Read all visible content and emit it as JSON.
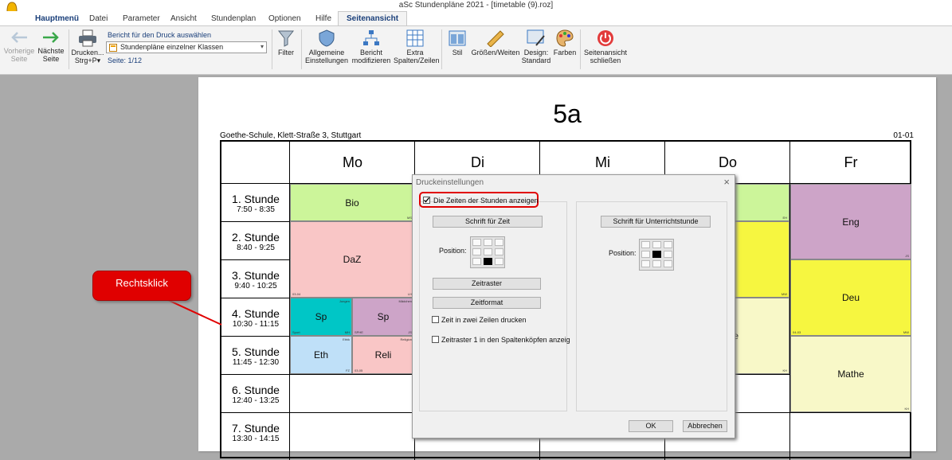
{
  "window": {
    "title": "aSc Stundenpläne 2021 - [timetable (9).roz]"
  },
  "menu_tabs": [
    {
      "label": "Hauptmenü"
    },
    {
      "label": "Datei"
    },
    {
      "label": "Parameter"
    },
    {
      "label": "Ansicht"
    },
    {
      "label": "Stundenplan"
    },
    {
      "label": "Optionen"
    },
    {
      "label": "Hilfe"
    },
    {
      "label": "Seitenansicht"
    }
  ],
  "ribbon": {
    "prev_page": {
      "line1": "Vorherige",
      "line2": "Seite"
    },
    "next_page": {
      "line1": "Nächste",
      "line2": "Seite"
    },
    "print": {
      "line1": "Drucken...",
      "line2": "Strg+P"
    },
    "report_label": "Bericht für den Druck auswählen",
    "report_select": "Stundenpläne einzelner Klassen",
    "page_info": "Seite: 1/12",
    "filter": "Filter",
    "general": {
      "line1": "Allgemeine",
      "line2": "Einstellungen"
    },
    "modify": {
      "line1": "Bericht",
      "line2": "modifizieren"
    },
    "extra": {
      "line1": "Extra",
      "line2": "Spalten/Zeilen"
    },
    "style": "Stil",
    "sizes": "Größen/Weiten",
    "design": {
      "line1": "Design:",
      "line2": "Standard"
    },
    "colors": "Farben",
    "close": {
      "line1": "Seitenansicht",
      "line2": "schließen"
    }
  },
  "page": {
    "class_title": "5a",
    "school": "Goethe-Schule, Klett-Straße 3, Stuttgart",
    "page_code": "01-01",
    "days": [
      "Mo",
      "Di",
      "Mi",
      "Do",
      "Fr"
    ],
    "periods": [
      {
        "name": "1. Stunde",
        "time": "7:50 - 8:35"
      },
      {
        "name": "2. Stunde",
        "time": "8:40 - 9:25"
      },
      {
        "name": "3. Stunde",
        "time": "9:40 - 10:25"
      },
      {
        "name": "4. Stunde",
        "time": "10:30 - 11:15"
      },
      {
        "name": "5. Stunde",
        "time": "11:45 - 12:30"
      },
      {
        "name": "6. Stunde",
        "time": "12:40 - 13:25"
      },
      {
        "name": "7. Stunde",
        "time": "13:30 - 14:15"
      }
    ],
    "lessons": {
      "mo_bio": {
        "subject": "Bio",
        "teacher": "MS"
      },
      "mo_daz": {
        "subject": "DaZ",
        "room": "03-04",
        "teacher": "LH"
      },
      "mo_sp1": {
        "subject": "Sp",
        "group": "Jungen",
        "room": "Sport",
        "teacher": "MH"
      },
      "mo_sp2": {
        "subject": "Sp",
        "group": "Mädchen",
        "room": "SPHE",
        "teacher": "JS"
      },
      "mo_eth": {
        "subject": "Eth",
        "group": "Ethik",
        "teacher": "FZ"
      },
      "mo_reli": {
        "subject": "Reli",
        "group": "Religion",
        "room": "03-05"
      },
      "do_1": {
        "teacher": "EH"
      },
      "do_2": {
        "teacher": "MW"
      },
      "do_4": {
        "subject_fragment": "e",
        "teacher": "KH"
      },
      "fr_eng": {
        "subject": "Eng",
        "teacher": "JS"
      },
      "fr_deu": {
        "subject": "Deu",
        "room": "04-03",
        "teacher": "MW"
      },
      "fr_mathe": {
        "subject": "Mathe",
        "teacher": "KH"
      }
    }
  },
  "callout": {
    "text": "Rechtsklick"
  },
  "dialog": {
    "title": "Druckeinstellungen",
    "show_times": {
      "label": "Die Zeiten der Stunden anzeigen",
      "checked": true
    },
    "font_time_button": "Schrift für Zeit",
    "position_label": "Position:",
    "time_grid_button": "Zeitraster",
    "time_format_button": "Zeitformat",
    "two_lines": {
      "label": "Zeit in zwei Zeilen drucken",
      "checked": false
    },
    "grid_in_headers": {
      "label": "Zeitraster 1 in den Spaltenköpfen anzeig",
      "checked": false
    },
    "font_lesson_button": "Schrift für Unterrichtstunde",
    "position_label_right": "Position:",
    "ok": "OK",
    "cancel": "Abbrechen"
  },
  "colors": {
    "bio": "#ccf59a",
    "daz": "#f9c6c6",
    "sport": "#00c6c6",
    "sport_girls": "#cda4c8",
    "ethik": "#bfe0f8",
    "religion": "#f9c6c6",
    "eng": "#cda4c8",
    "deu": "#f6f640",
    "mathe": "#f8f8c8",
    "callout": "#e00000"
  }
}
